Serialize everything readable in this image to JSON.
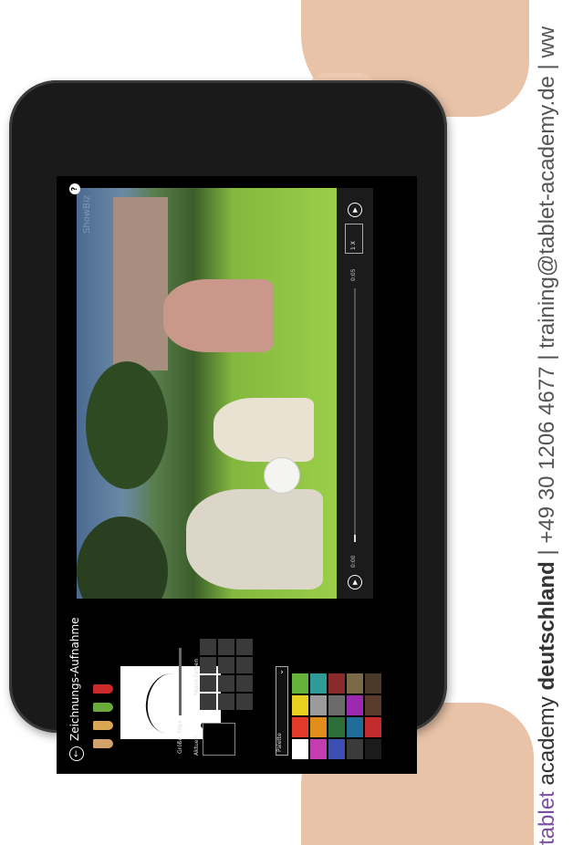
{
  "branding": {
    "brand_tablet": "tablet",
    "brand_academy": "academy",
    "brand_deutschland": "deutschland",
    "contact_line": " | +49 30 1206 4677 | training@tablet-academy.de | ww"
  },
  "app": {
    "logo": "ShowBiz",
    "help": "?"
  },
  "drawing_panel": {
    "back": "←",
    "title": "Zeichnungs-Aufnahme",
    "size_label": "Größe: 50px",
    "current_label": "Aktuell",
    "my_colors_label": "Meine Farben",
    "palette_label": "Palette",
    "palette_colors": [
      "#ffffff",
      "#e23b2b",
      "#e7d020",
      "#65b33b",
      "#c33db0",
      "#e08d1b",
      "#9b9b9b",
      "#2f9b98",
      "#3c4eb1",
      "#2c6f39",
      "#6b6b6b",
      "#8a2b2b",
      "#3b3b3b",
      "#1f6e9a",
      "#9b2ab0",
      "#7b6a48",
      "#1b1b1b",
      "#c22c2c",
      "#5a3a2a",
      "#4a3a2a"
    ],
    "tool_colors": [
      "#d3a26a",
      "#d9a654",
      "#6aaa3a",
      "#cc2a2a"
    ]
  },
  "player": {
    "play": "▶",
    "time_start": "0:00",
    "time_end": "0:05",
    "progress": 0.03,
    "speed": "1 X",
    "next": "▶"
  }
}
